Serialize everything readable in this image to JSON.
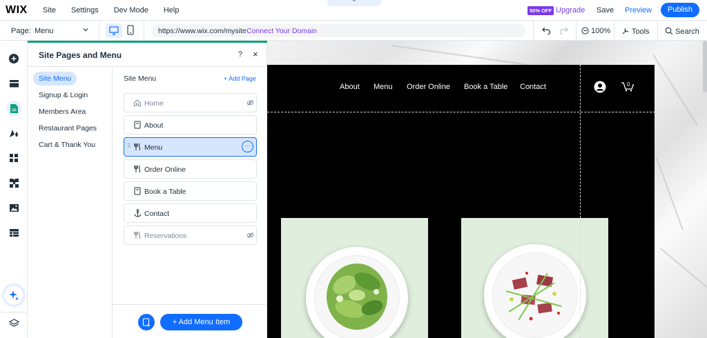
{
  "topbar": {
    "logo": "WIX",
    "menu": [
      "Site",
      "Settings",
      "Dev Mode",
      "Help"
    ],
    "collapse_glyph": "⌃",
    "promo_badge": "50% OFF",
    "upgrade": "Upgrade",
    "save": "Save",
    "preview": "Preview",
    "publish": "Publish"
  },
  "subbar": {
    "page_label": "Page:",
    "page_value": "Menu",
    "url": "https://www.wix.com/mysite",
    "connect_domain": "Connect Your Domain",
    "zoom": "100%",
    "tools": "Tools",
    "search": "Search"
  },
  "rail": {
    "icons": [
      "add-elements-icon",
      "sections-icon",
      "pages-icon",
      "design-icon",
      "apps-icon",
      "business-apps-icon",
      "media-icon",
      "cms-icon"
    ],
    "active_index": 2
  },
  "panel": {
    "title": "Site Pages and Menu",
    "help": "?",
    "close": "×",
    "categories": [
      "Site Menu",
      "Signup & Login",
      "Members Area",
      "Restaurant Pages",
      "Cart & Thank You"
    ],
    "active_category": 0,
    "column_title": "Site Menu",
    "add_page": "+ Add Page",
    "pages": [
      {
        "label": "Home",
        "icon": "home-icon",
        "hidden": true,
        "selected": false
      },
      {
        "label": "About",
        "icon": "page-icon",
        "hidden": false,
        "selected": false
      },
      {
        "label": "Menu",
        "icon": "fork-knife-icon",
        "hidden": false,
        "selected": true
      },
      {
        "label": "Order Online",
        "icon": "fork-knife-icon",
        "hidden": false,
        "selected": false
      },
      {
        "label": "Book a Table",
        "icon": "page-icon",
        "hidden": false,
        "selected": false
      },
      {
        "label": "Contact",
        "icon": "anchor-icon",
        "hidden": false,
        "selected": false
      },
      {
        "label": "Reservations",
        "icon": "fork-knife-icon",
        "hidden": true,
        "selected": false
      }
    ],
    "add_menu_item": "+ Add Menu Item"
  },
  "site": {
    "nav": [
      "About",
      "Menu",
      "Order Online",
      "Book a Table",
      "Contact"
    ],
    "cart_count": "0"
  },
  "colors": {
    "accent": "#116dff",
    "upgrade": "#7a3ae8",
    "panel_top": "#0aa37b",
    "selected_bg": "#d6e6fe",
    "site_bg": "#000000",
    "card_bg": "#dfeedd"
  }
}
